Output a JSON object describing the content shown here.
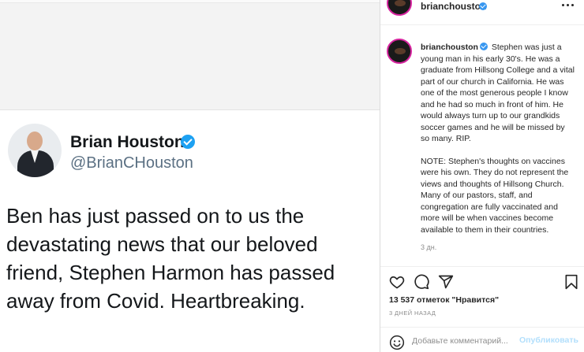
{
  "tweet": {
    "name": "Brian Houston",
    "handle": "@BrianCHouston",
    "text": "Ben has just passed on to us the devastating news that our beloved friend, Stephen Harmon has passed away from Covid. Heartbreaking."
  },
  "post": {
    "username": "brianchouston",
    "caption_part1": "Stephen was just a young man in his early 30's. He was a graduate from Hillsong College and a vital part of our church in California. He was one of the most generous people I know and he had so much in front of him. He would always turn up to our grandkids soccer games and he will be missed by so many. RIP.",
    "caption_part2": "NOTE: Stephen's thoughts on vaccines were his own. They do not represent the views and thoughts of Hillsong Church. Many of our pastors, staff, and congregation are fully vaccinated and more will be when vaccines become available to them in their countries.",
    "caption_time": "3 дн.",
    "likes": "13 537 отметок \"Нравится\"",
    "date": "3 ДНЕЙ НАЗАД"
  },
  "comment": {
    "placeholder": "Добавьте комментарий...",
    "publish_label": "Опубликовать"
  },
  "icons": {
    "like": "heart-icon",
    "comment": "comment-icon",
    "share": "share-icon",
    "save": "bookmark-icon",
    "emoji": "emoji-icon",
    "more": "more-icon",
    "verified": "verified-badge-icon"
  },
  "colors": {
    "verified_blue": "#3897f0",
    "twitter_blue": "#1da1f2",
    "publish_disabled": "#b2dffc",
    "muted": "#8e8e8e"
  }
}
